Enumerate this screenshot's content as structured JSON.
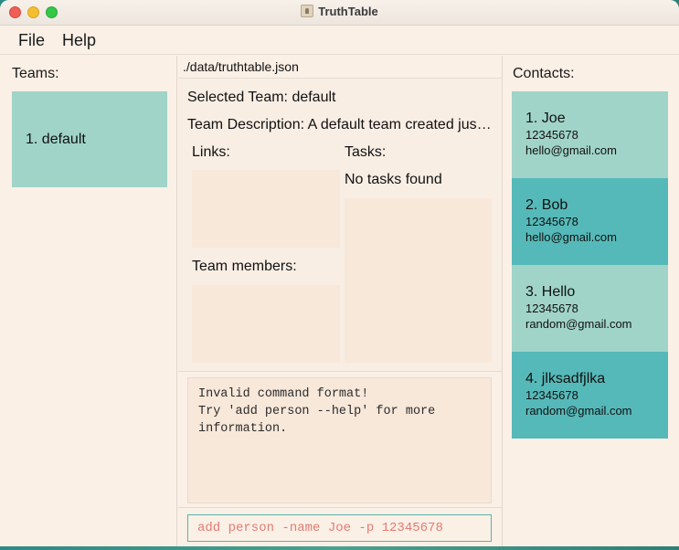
{
  "window": {
    "title": "TruthTable"
  },
  "menu": {
    "file": "File",
    "help": "Help"
  },
  "teams": {
    "heading": "Teams:",
    "items": [
      "1. default"
    ]
  },
  "path": "./data/truthtable.json",
  "team_info": {
    "selected": "Selected Team: default",
    "description": "Team Description: A default team created just fo...",
    "links_heading": "Links:",
    "tasks_heading": "Tasks:",
    "tasks_empty": "No tasks found",
    "members_heading": "Team members:"
  },
  "result": "Invalid command format! \nTry 'add person --help' for more\ninformation.",
  "command": {
    "value": "add person -name Joe -p 12345678"
  },
  "contacts": {
    "heading": "Contacts:",
    "items": [
      {
        "name": "1. Joe",
        "phone": "12345678",
        "email": "hello@gmail.com"
      },
      {
        "name": "2. Bob",
        "phone": "12345678",
        "email": "hello@gmail.com"
      },
      {
        "name": "3. Hello",
        "phone": "12345678",
        "email": "random@gmail.com"
      },
      {
        "name": "4. jlksadfjlka",
        "phone": "12345678",
        "email": "random@gmail.com"
      }
    ]
  },
  "colors": {
    "card_light": "#a0d4c9",
    "card_dark": "#56b9b9",
    "background": "#fbf0e6",
    "command_text": "#e47a72"
  }
}
